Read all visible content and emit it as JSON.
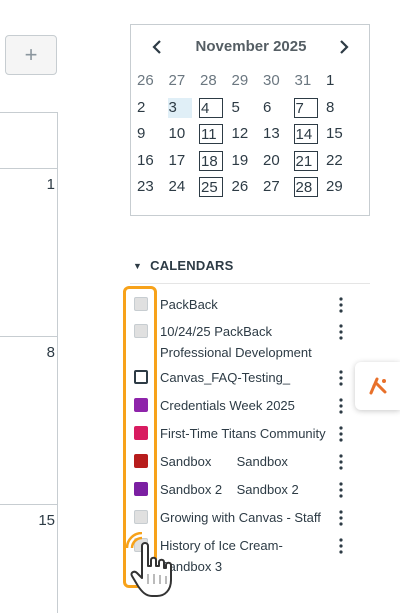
{
  "toolbar": {
    "add_label": "+"
  },
  "main_calendar": {
    "visible_days": [
      "1",
      "8",
      "15"
    ]
  },
  "mini_calendar": {
    "title": "November 2025",
    "prev_icon": "chevron-left-icon",
    "next_icon": "chevron-right-icon",
    "weeks": [
      [
        "26",
        "27",
        "28",
        "29",
        "30",
        "31",
        "1"
      ],
      [
        "2",
        "3",
        "4",
        "5",
        "6",
        "7",
        "8"
      ],
      [
        "9",
        "10",
        "11",
        "12",
        "13",
        "14",
        "15"
      ],
      [
        "16",
        "17",
        "18",
        "19",
        "20",
        "21",
        "22"
      ],
      [
        "23",
        "24",
        "25",
        "26",
        "27",
        "28",
        "29"
      ]
    ],
    "today": "3",
    "boxed_days": [
      "4",
      "7",
      "11",
      "14",
      "18",
      "21",
      "25",
      "28"
    ]
  },
  "calendars": {
    "heading": "CALENDARS",
    "items": [
      {
        "label": "PackBack",
        "color": "#e0e0e0",
        "checked": false
      },
      {
        "label": "10/24/25 PackBack Professional Development",
        "color": "#e0e0e0",
        "checked": false
      },
      {
        "label": "Canvas_FAQ-Testing_",
        "color": "#ffffff",
        "checked": false
      },
      {
        "label": "Credentials Week 2025",
        "color": "#8e24aa",
        "checked": true
      },
      {
        "label": "First-Time Titans Community",
        "color": "#d81b60",
        "checked": true
      },
      {
        "label": "Sandbox       Sandbox",
        "color": "#b71c1c",
        "checked": true
      },
      {
        "label": "Sandbox 2    Sandbox 2",
        "color": "#7b1fa2",
        "checked": true
      },
      {
        "label": "Growing with Canvas - Staff",
        "color": "#e0e0e0",
        "checked": false
      },
      {
        "label": "History of Ice Cream-Sandbox 3",
        "color": "#e0e0e0",
        "checked": false
      }
    ],
    "menu_icon": "kebab-menu-icon"
  },
  "side_tab": {
    "icon": "app-logo-icon"
  },
  "colors": {
    "highlight": "#f7a21a",
    "logo": "#e8702a",
    "today_bg": "#e0eff7"
  }
}
